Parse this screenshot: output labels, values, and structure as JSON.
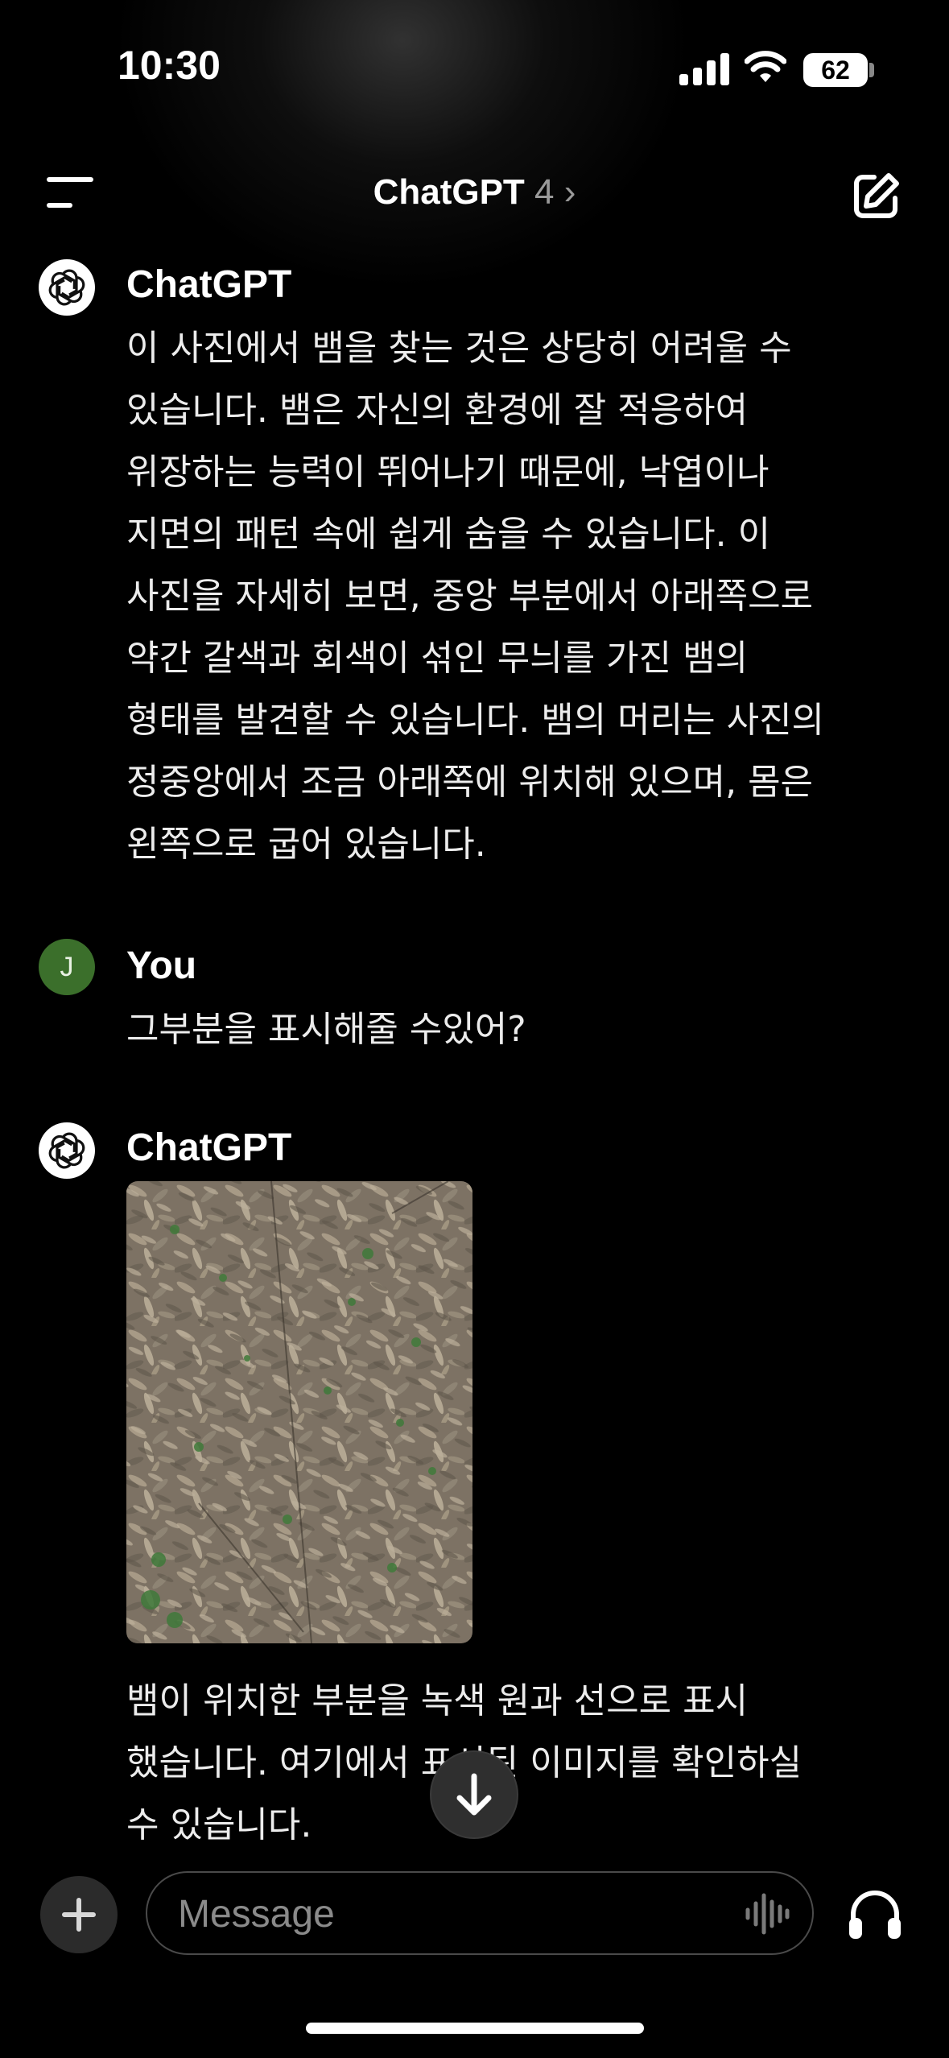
{
  "status_bar": {
    "time": "10:30",
    "battery": "62"
  },
  "header": {
    "title": "ChatGPT",
    "version": "4",
    "chevron": "›"
  },
  "icons": {
    "menu": "menu-icon",
    "edit": "edit-icon",
    "openai": "openai-logo-icon",
    "scroll_down": "arrow-down-icon",
    "plus": "plus-icon",
    "voice": "voice-waveform-icon",
    "headphones": "headphones-icon"
  },
  "messages": [
    {
      "sender": "ChatGPT",
      "lines": [
        "이 사진에서 뱀을 찾는 것은 상당히 어려울 수",
        "있습니다. 뱀은 자신의 환경에 잘 적응하여",
        "위장하는 능력이 뛰어나기 때문에, 낙엽이나",
        "지면의 패턴 속에 쉽게 숨을 수 있습니다. 이",
        "사진을 자세히 보면, 중앙 부분에서 아래쪽으로",
        "약간 갈색과 회색이 섞인 무늬를 가진 뱀의",
        "형태를 발견할 수 있습니다. 뱀의 머리는 사진의",
        "정중앙에서 조금 아래쪽에 위치해 있으며, 몸은",
        "왼쪽으로 굽어 있습니다."
      ]
    },
    {
      "sender": "You",
      "avatar_initial": "J",
      "lines": [
        "그부분을 표시해줄 수있어?"
      ]
    },
    {
      "sender": "ChatGPT",
      "lines": [
        "뱀이 위치한 부분을 녹색 원과 선으로 표시",
        "했습니다. 여기에서 표시된 이미지를 확인하실",
        "수 있습니다."
      ]
    }
  ],
  "composer": {
    "placeholder": "Message",
    "value": ""
  }
}
